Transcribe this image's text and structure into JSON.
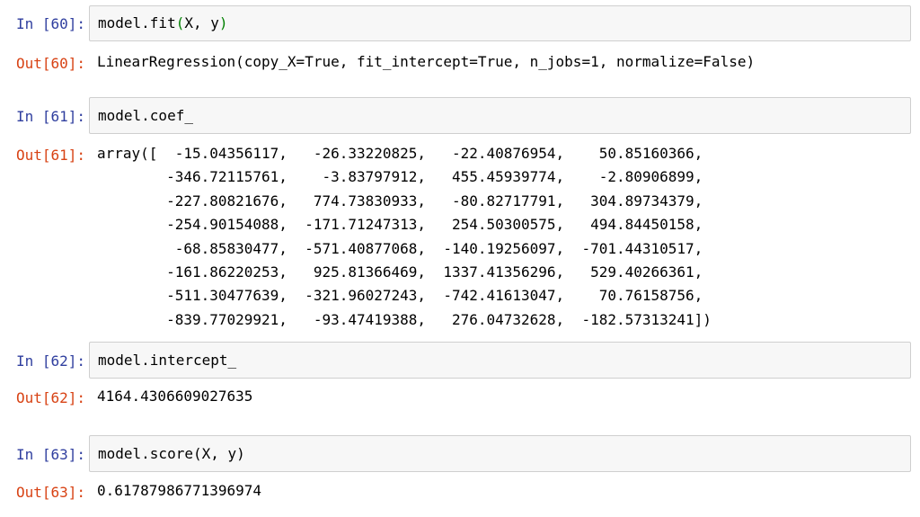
{
  "cells": [
    {
      "in_prompt": "In [60]:",
      "code_parts": [
        "model.fit",
        "(",
        "X, y",
        ")"
      ],
      "out_prompt": "Out[60]:",
      "output": "LinearRegression(copy_X=True, fit_intercept=True, n_jobs=1, normalize=False)"
    },
    {
      "in_prompt": "In [61]:",
      "code": "model.coef_",
      "out_prompt": "Out[61]:",
      "output": "array([  -15.04356117,   -26.33220825,   -22.40876954,    50.85160366,\n        -346.72115761,    -3.83797912,   455.45939774,    -2.80906899,\n        -227.80821676,   774.73830933,   -80.82717791,   304.89734379,\n        -254.90154088,  -171.71247313,   254.50300575,   494.84450158,\n         -68.85830477,  -571.40877068,  -140.19256097,  -701.44310517,\n        -161.86220253,   925.81366469,  1337.41356296,   529.40266361,\n        -511.30477639,  -321.96027243,  -742.41613047,    70.76158756,\n        -839.77029921,   -93.47419388,   276.04732628,  -182.57313241])"
    },
    {
      "in_prompt": "In [62]:",
      "code": "model.intercept_",
      "out_prompt": "Out[62]:",
      "output": "4164.4306609027635"
    },
    {
      "in_prompt": "In [63]:",
      "code": "model.score(X, y)",
      "out_prompt": "Out[63]:",
      "output": "0.61787986771396974"
    }
  ],
  "colors": {
    "in_prompt": "#303f9f",
    "out_prompt": "#d84315",
    "input_bg": "#f7f7f7",
    "input_border": "#cfcfcf",
    "bracket_match": "#008000"
  }
}
